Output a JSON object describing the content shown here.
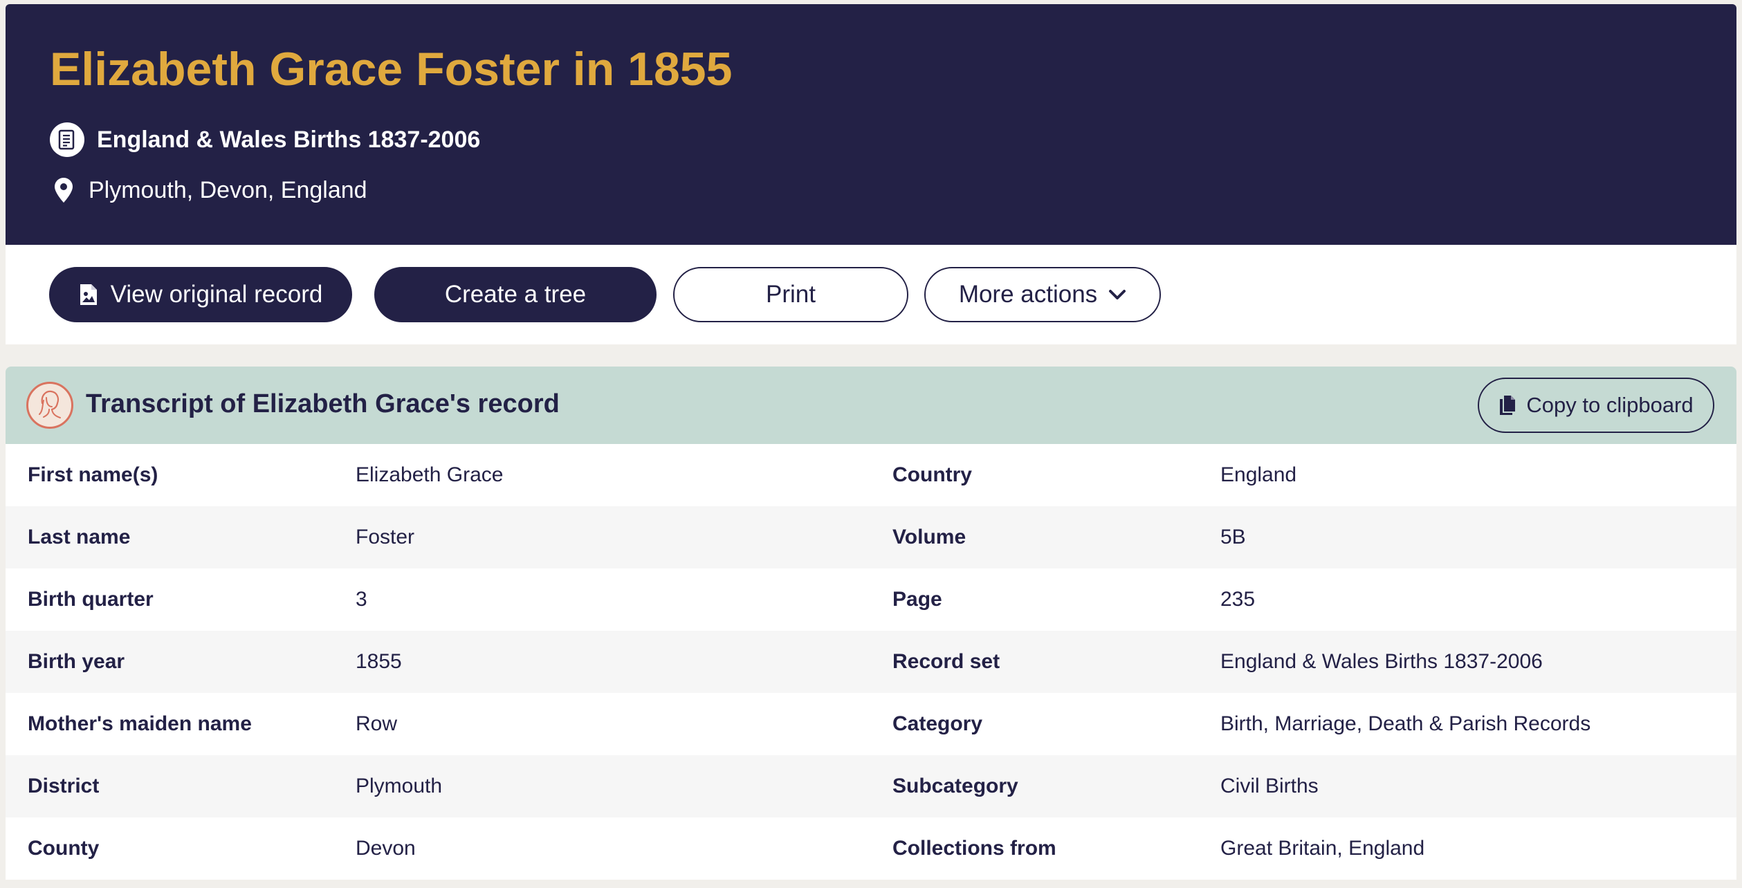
{
  "header": {
    "title": "Elizabeth Grace Foster in 1855",
    "record_set": "England & Wales Births 1837-2006",
    "location": "Plymouth, Devon, England"
  },
  "actions": {
    "view_original": "View original record",
    "create_tree": "Create a tree",
    "print": "Print",
    "more_actions": "More actions"
  },
  "transcript": {
    "title": "Transcript of Elizabeth Grace's record",
    "copy_label": "Copy to clipboard",
    "rows": [
      {
        "label": "First name(s)",
        "value": "Elizabeth Grace",
        "label2": "Country",
        "value2": "England"
      },
      {
        "label": "Last name",
        "value": "Foster",
        "label2": "Volume",
        "value2": "5B"
      },
      {
        "label": "Birth quarter",
        "value": "3",
        "label2": "Page",
        "value2": "235"
      },
      {
        "label": "Birth year",
        "value": "1855",
        "label2": "Record set",
        "value2": "England & Wales Births 1837-2006"
      },
      {
        "label": "Mother's maiden name",
        "value": "Row",
        "label2": "Category",
        "value2": "Birth, Marriage, Death & Parish Records"
      },
      {
        "label": "District",
        "value": "Plymouth",
        "label2": "Subcategory",
        "value2": "Civil Births"
      },
      {
        "label": "County",
        "value": "Devon",
        "label2": "Collections from",
        "value2": "Great Britain, England"
      }
    ]
  },
  "colors": {
    "header_bg": "#232146",
    "title_gold": "#e0a93e",
    "transcript_header_bg": "#c5dad3",
    "avatar_accent": "#d9735f",
    "page_bg": "#f1efeb"
  },
  "icons": {
    "record": "document-icon",
    "location": "map-pin-icon",
    "view_original": "document-image-icon",
    "more": "chevron-down-icon",
    "copy": "copy-icon",
    "avatar": "woman-portrait-icon"
  }
}
